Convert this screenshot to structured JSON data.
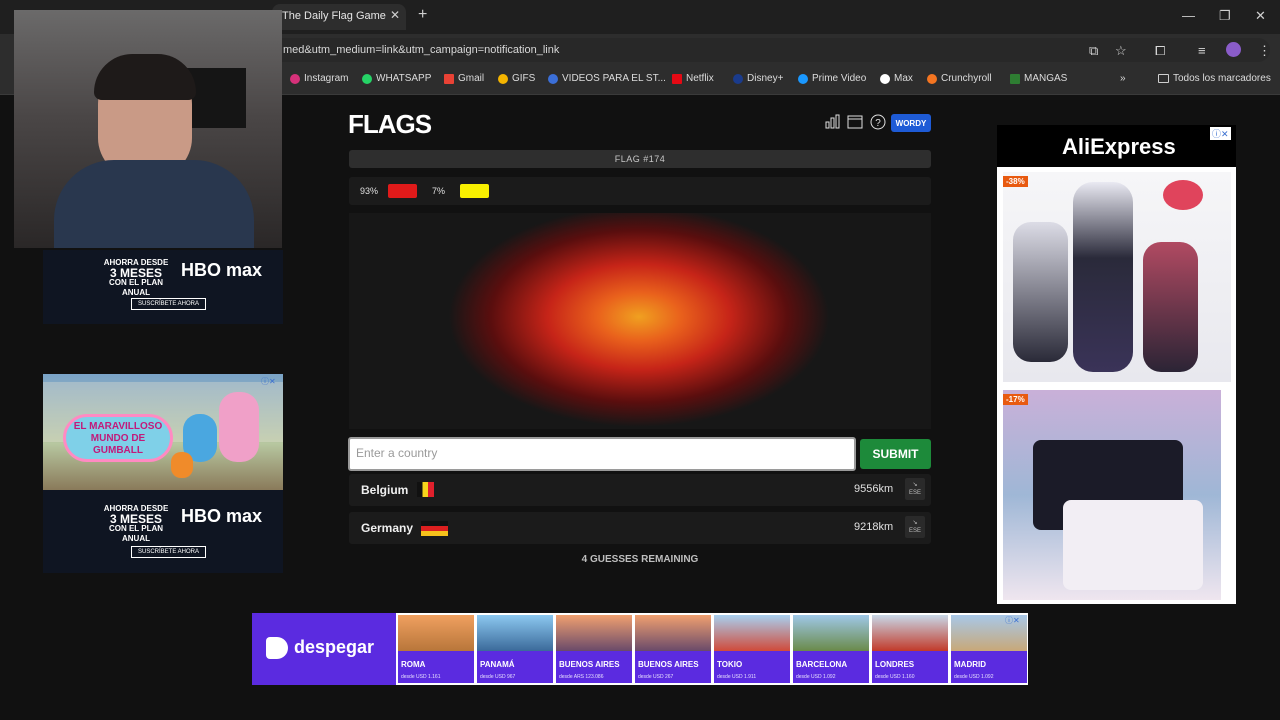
{
  "browser": {
    "tab_title": "The Daily Flag Game",
    "url": "med&utm_medium=link&utm_campaign=notification_link",
    "bookmarks": [
      "Instagram",
      "WHATSAPP",
      "Gmail",
      "GIFS",
      "VIDEOS PARA EL ST...",
      "Netflix",
      "Disney+",
      "Prime Video",
      "Max",
      "Crunchyroll",
      "MANGAS"
    ],
    "all_bookmarks": "Todos los marcadores"
  },
  "left_ads": {
    "hbo_line1": "AHORRA DESDE",
    "hbo_line2": "3 MESES",
    "hbo_line3": "CON EL PLAN ANUAL",
    "hbo_logo": "HBO max",
    "hbo_button": "SUSCRÍBETE AHORA",
    "gumball_text": "EL MARAVILLOSO MUNDO DE GUMBALL"
  },
  "game": {
    "logo": "FLAGS",
    "wordy_button": "WORDY",
    "flag_number": "FLAG #174",
    "colors": [
      {
        "percent": "93%",
        "hex": "#e01a1a"
      },
      {
        "percent": "7%",
        "hex": "#f8f000"
      }
    ],
    "input_placeholder": "Enter a country",
    "submit_label": "SUBMIT",
    "guesses": [
      {
        "country": "Belgium",
        "distance": "9556km",
        "direction": "ESE"
      },
      {
        "country": "Germany",
        "distance": "9218km",
        "direction": "ESE"
      }
    ],
    "remaining": "4 GUESSES REMAINING"
  },
  "aliexpress": {
    "title": "AliExpress",
    "discount1": "-38%",
    "discount2": "-17%"
  },
  "despegar": {
    "brand": "despegar",
    "cards": [
      {
        "city": "ROMA",
        "price": "desde USD 1.161"
      },
      {
        "city": "PANAMÁ",
        "price": "desde USD 967"
      },
      {
        "city": "BUENOS AIRES",
        "price": "desde ARS 123.086"
      },
      {
        "city": "BUENOS AIRES",
        "price": "desde USD 267"
      },
      {
        "city": "TOKIO",
        "price": "desde USD 1.911"
      },
      {
        "city": "BARCELONA",
        "price": "desde USD 1.092"
      },
      {
        "city": "LONDRES",
        "price": "desde USD 1.160"
      },
      {
        "city": "MADRID",
        "price": "desde USD 1.092"
      }
    ]
  }
}
